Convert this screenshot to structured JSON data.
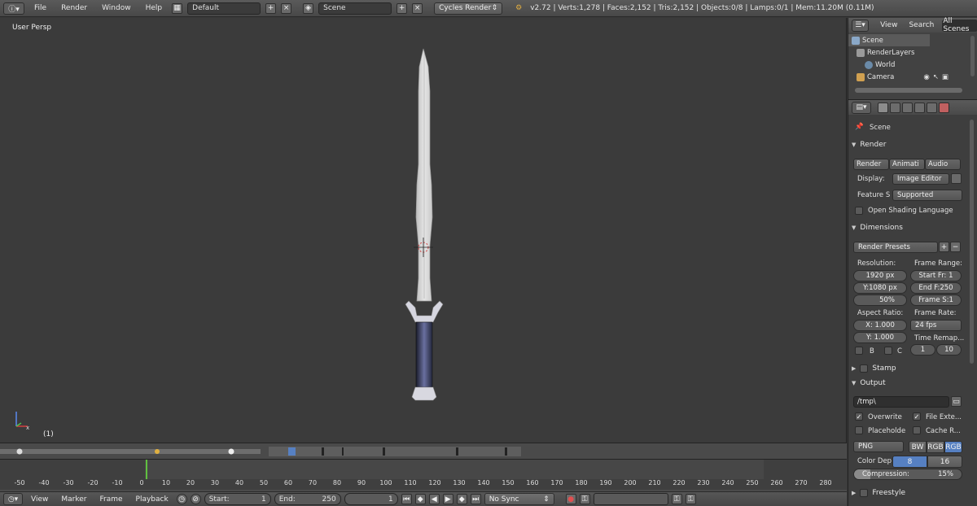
{
  "topbar": {
    "editor_icon": "info-icon",
    "menus": [
      "File",
      "Render",
      "Window",
      "Help"
    ],
    "layout": "Default",
    "scene": "Scene",
    "engine": "Cycles Render",
    "stats": "v2.72 | Verts:1,278 | Faces:2,152 | Tris:2,152 | Objects:0/8 | Lamps:0/1 | Mem:11.20M (0.11M)"
  },
  "viewport": {
    "label": "User Persp",
    "frame_label": "(1)"
  },
  "timeline": {
    "ruler_ticks": [
      "-50",
      "-40",
      "-30",
      "-20",
      "-10",
      "0",
      "10",
      "20",
      "30",
      "40",
      "50",
      "60",
      "70",
      "80",
      "90",
      "100",
      "110",
      "120",
      "130",
      "140",
      "150",
      "160",
      "170",
      "180",
      "190",
      "200",
      "210",
      "220",
      "230",
      "240",
      "250",
      "260",
      "270",
      "280"
    ],
    "current_frame": 1,
    "footer": {
      "menus": [
        "View",
        "Marker",
        "Frame",
        "Playback"
      ],
      "start_label": "Start:",
      "start_value": "1",
      "end_label": "End:",
      "end_value": "250",
      "current_value": "1",
      "sync": "No Sync"
    }
  },
  "outliner": {
    "tabs": [
      "View",
      "Search",
      "All Scenes"
    ],
    "rows": [
      "Scene",
      "RenderLayers",
      "World",
      "Camera"
    ]
  },
  "properties": {
    "scene_label": "Scene",
    "render_panel": "Render",
    "render_buttons": [
      "Render",
      "Animati",
      "Audio"
    ],
    "display_label": "Display:",
    "display_value": "Image Editor",
    "feature_label": "Feature S",
    "feature_value": "Supported",
    "osl_label": "Open Shading Language",
    "dimensions_panel": "Dimensions",
    "render_presets": "Render Presets",
    "resolution_label": "Resolution:",
    "res_x": "1920 px",
    "res_y": "Y:1080 px",
    "res_pct": "50%",
    "frame_range_label": "Frame Range:",
    "start_fr": "Start Fr: 1",
    "end_fr": "End F:250",
    "frame_step": "Frame S:1",
    "aspect_label": "Aspect Ratio:",
    "aspect_x": "X:   1.000",
    "aspect_y": "Y:   1.000",
    "frame_rate_label": "Frame Rate:",
    "fps": "24 fps",
    "time_remap_label": "Time Remap...",
    "remap_old": "1",
    "remap_new": "10",
    "border_b": "B",
    "border_c": "C",
    "stamp_panel": "Stamp",
    "output_panel": "Output",
    "output_path": "/tmp\\",
    "overwrite": "Overwrite",
    "file_ext": "File Exte...",
    "placeholder": "Placeholde",
    "cache_result": "Cache R...",
    "format": "PNG",
    "color_modes": [
      "BW",
      "RGB",
      "RGB"
    ],
    "color_depth_label": "Color Dep",
    "depth_8": "8",
    "depth_16": "16",
    "compression": "Compression:",
    "compression_value": "15%",
    "freestyle_panel": "Freestyle"
  },
  "colors": {
    "accent": "#5680c2",
    "current_frame_line": "#60c040",
    "sword_blade": "#d8d8d8",
    "sword_handle": "#2a2e44"
  }
}
